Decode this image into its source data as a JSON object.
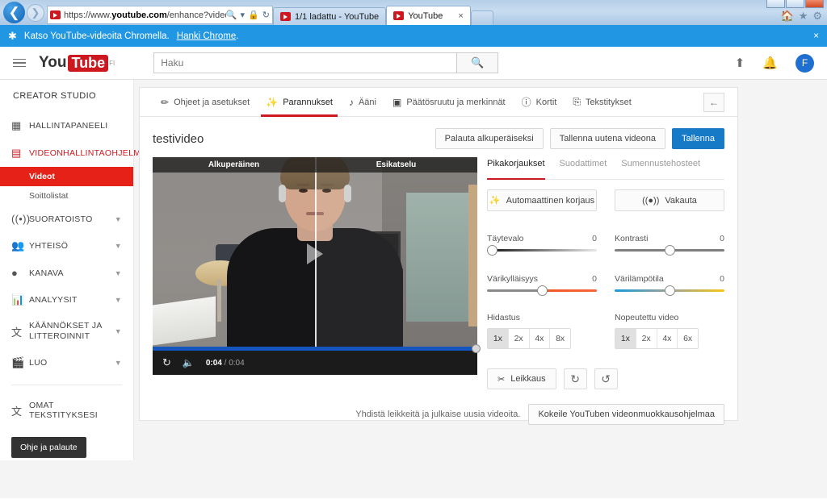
{
  "browser": {
    "url_prefix": "https://www.",
    "url_domain": "youtube.com",
    "url_path": "/enhance?video_referrer=v",
    "tabs": [
      {
        "title": "1/1 ladattu - YouTube",
        "active": false
      },
      {
        "title": "YouTube",
        "active": true
      }
    ],
    "close_label": "×"
  },
  "promo": {
    "text": "Katso YouTube-videoita Chromella.",
    "link": "Hanki Chrome",
    "period": ".",
    "close": "×"
  },
  "masthead": {
    "logo_you": "You",
    "logo_tube": "Tube",
    "locale": "FI",
    "search_placeholder": "Haku",
    "avatar_letter": "F"
  },
  "sidebar": {
    "title": "CREATOR STUDIO",
    "items": [
      {
        "label": "HALLINTAPANEELI",
        "icon": "dashboard-icon",
        "red": false,
        "chevron": false
      },
      {
        "label": "VIDEONHALLINTAOHJELMA",
        "icon": "video-manager-icon",
        "red": true,
        "chevron": false
      }
    ],
    "sub_items": [
      {
        "label": "Videot",
        "active": true
      },
      {
        "label": "Soittolistat",
        "active": false
      }
    ],
    "groups": [
      {
        "label": "SUORATOISTO",
        "icon": "broadcast-icon"
      },
      {
        "label": "YHTEISÖ",
        "icon": "community-icon"
      },
      {
        "label": "KANAVA",
        "icon": "channel-icon"
      },
      {
        "label": "ANALYYSIT",
        "icon": "analytics-icon"
      },
      {
        "label": "KÄÄNNÖKSET JA LITTEROINNIT",
        "icon": "translate-icon"
      },
      {
        "label": "LUO",
        "icon": "create-icon"
      }
    ],
    "my_subtitles": "OMAT TEKSTITYKSESI",
    "help_button": "Ohje ja palaute"
  },
  "editor": {
    "tabs": [
      {
        "label": "Ohjeet ja asetukset",
        "icon": "pencil-icon",
        "active": false
      },
      {
        "label": "Parannukset",
        "icon": "magic-wand-icon",
        "active": true
      },
      {
        "label": "Ääni",
        "icon": "music-note-icon",
        "active": false
      },
      {
        "label": "Päätösruutu ja merkinnät",
        "icon": "endscreen-icon",
        "active": false
      },
      {
        "label": "Kortit",
        "icon": "info-icon",
        "active": false
      },
      {
        "label": "Tekstitykset",
        "icon": "cc-icon",
        "active": false
      }
    ],
    "video_title": "testivideo",
    "buttons": {
      "revert": "Palauta alkuperäiseksi",
      "save_as_new": "Tallenna uutena videona",
      "save": "Tallenna"
    }
  },
  "player": {
    "label_original": "Alkuperäinen",
    "label_preview": "Esikatselu",
    "current_time": "0:04",
    "separator": " / ",
    "duration": "0:04"
  },
  "controls": {
    "tabs": [
      {
        "label": "Pikakorjaukset",
        "active": true
      },
      {
        "label": "Suodattimet",
        "active": false
      },
      {
        "label": "Sumennustehosteet",
        "active": false
      }
    ],
    "auto_fix": "Automaattinen korjaus",
    "stabilize": "Vakauta",
    "sliders": [
      {
        "name": "Täytevalo",
        "value": "0",
        "position": 0
      },
      {
        "name": "Kontrasti",
        "value": "0",
        "position": 50
      },
      {
        "name": "Värikylläisyys",
        "value": "0",
        "position": 50
      },
      {
        "name": "Värilämpötila",
        "value": "0",
        "position": 50
      }
    ],
    "slow_label": "Hidastus",
    "slow_options": [
      "1x",
      "2x",
      "4x",
      "8x"
    ],
    "slow_selected": "1x",
    "fast_label": "Nopeutettu video",
    "fast_options": [
      "1x",
      "2x",
      "4x",
      "6x"
    ],
    "fast_selected": "1x",
    "trim": "Leikkaus",
    "rotate_cw": "↻",
    "rotate_ccw": "↺"
  },
  "footer": {
    "text": "Yhdistä leikkeitä ja julkaise uusia videoita.",
    "cta": "Kokeile YouTuben videonmuokkausohjelmaa"
  }
}
